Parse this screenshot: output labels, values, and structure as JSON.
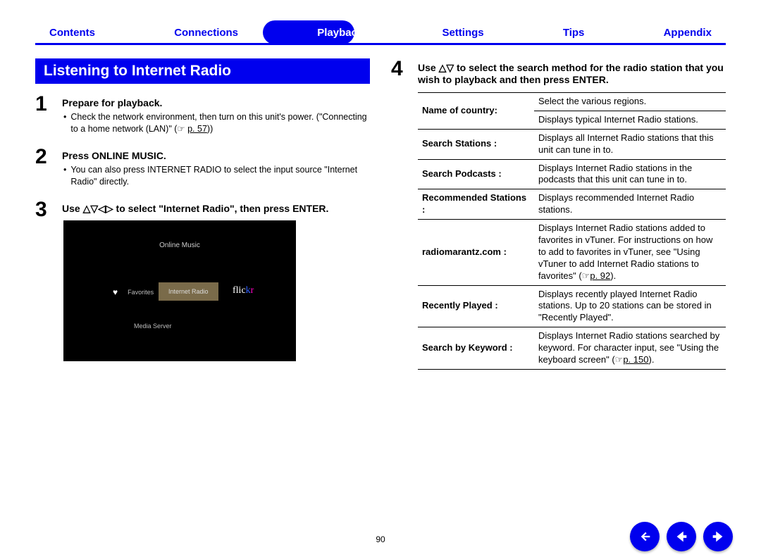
{
  "nav": {
    "items": [
      "Contents",
      "Connections",
      "Playback",
      "Settings",
      "Tips",
      "Appendix"
    ],
    "active_index": 2
  },
  "section_title": "Listening to Internet Radio",
  "steps_left": [
    {
      "num": "1",
      "heading": "Prepare for playback.",
      "bullets": [
        {
          "text": "Check the network environment, then turn on this unit's power. (\"Connecting to a home network (LAN)\" (☞",
          "link": "p. 57",
          "after": "))"
        }
      ]
    },
    {
      "num": "2",
      "heading": "Press ONLINE MUSIC.",
      "bullets": [
        {
          "text": "You can also press INTERNET RADIO to select the input source \"Internet Radio\" directly."
        }
      ]
    },
    {
      "num": "3",
      "heading_pre": "Use ",
      "heading_icons": "△▽◁▷",
      "heading_post": " to select \"Internet Radio\", then press ENTER."
    }
  ],
  "screen": {
    "title": "Online Music",
    "favorites": "Favorites",
    "selected": "Internet Radio",
    "media": "Media Server",
    "flickr": "flickr"
  },
  "step4": {
    "num": "4",
    "heading_pre": "Use ",
    "heading_icons": "△▽",
    "heading_post": " to select the search method for the radio station that you wish to playback and then press ENTER."
  },
  "table": [
    {
      "label": "Name of country:",
      "desc": "Select the various regions."
    },
    {
      "label": "",
      "desc": "Displays typical Internet Radio stations."
    },
    {
      "label": "Search Stations :",
      "desc": "Displays all Internet Radio stations that this unit can tune in to."
    },
    {
      "label": "Search Podcasts :",
      "desc": "Displays Internet Radio stations in the podcasts that this unit can tune in to."
    },
    {
      "label": "Recommended Stations :",
      "desc": "Displays recommended Internet Radio stations."
    },
    {
      "label": "radiomarantz.com :",
      "desc_pre": "Displays Internet Radio stations added to favorites in vTuner. For instructions on how to add to favorites in vTuner, see \"Using vTuner to add Internet Radio stations to favorites\" (☞",
      "link": "p. 92",
      "desc_post": ")."
    },
    {
      "label": "Recently Played :",
      "desc": "Displays recently played Internet Radio stations. Up to 20 stations can be stored in \"Recently Played\"."
    },
    {
      "label": "Search by Keyword :",
      "desc_pre": "Displays Internet Radio stations searched by keyword. For character input, see \"Using the keyboard screen\" (☞",
      "link": "p. 150",
      "desc_post": ")."
    }
  ],
  "page_number": "90",
  "nav_buttons": {
    "home": "⮌",
    "prev": "←",
    "next": "→"
  }
}
